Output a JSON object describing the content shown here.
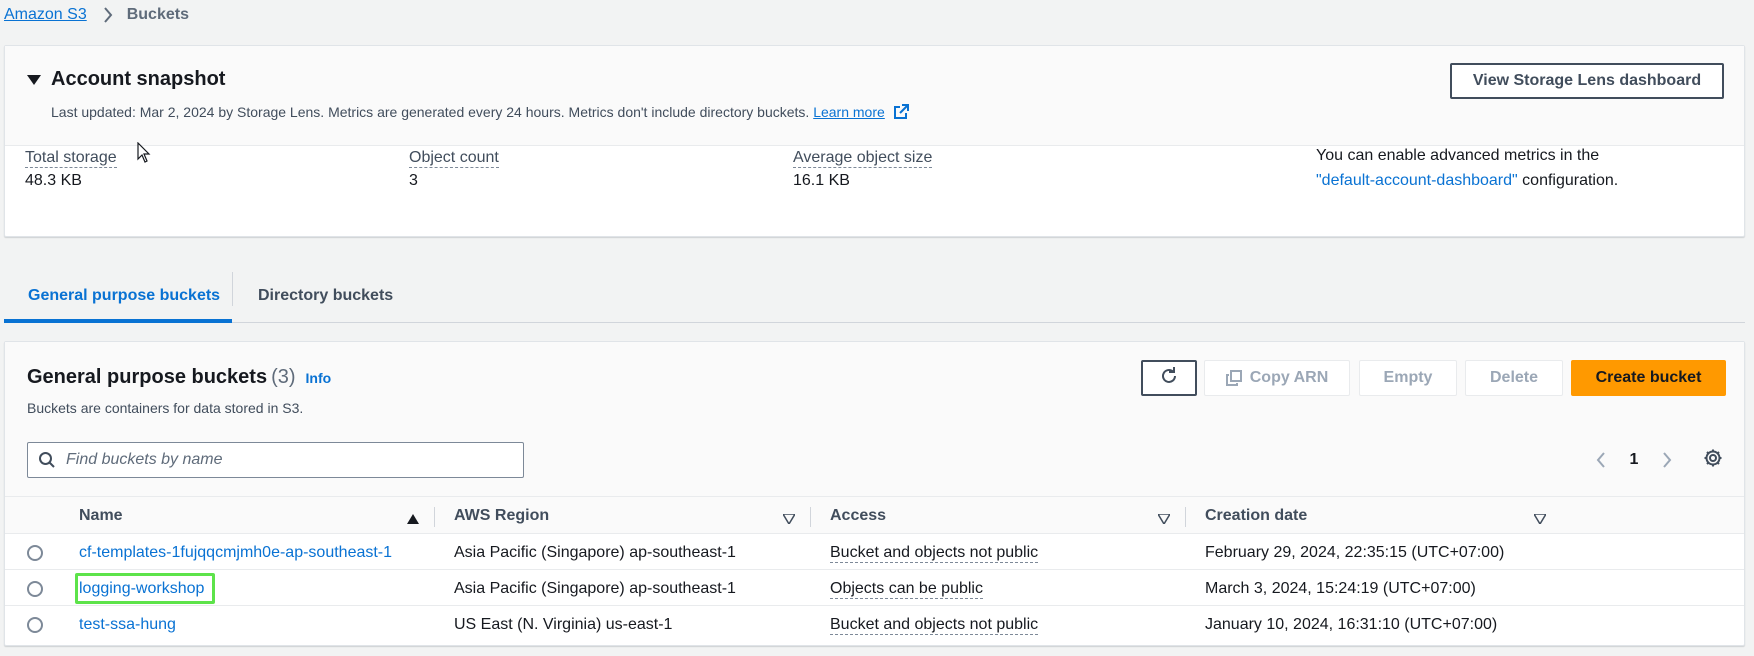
{
  "breadcrumb": {
    "root": "Amazon S3",
    "current": "Buckets"
  },
  "snapshot": {
    "title": "Account snapshot",
    "description": "Last updated: Mar 2, 2024 by Storage Lens. Metrics are generated every 24 hours. Metrics don't include directory buckets.",
    "learn_more": "Learn more",
    "lens_button": "View Storage Lens dashboard",
    "metrics": [
      {
        "label": "Total storage",
        "value": "48.3 KB"
      },
      {
        "label": "Object count",
        "value": "3"
      },
      {
        "label": "Average object size",
        "value": "16.1 KB"
      }
    ],
    "advanced_line1": "You can enable advanced metrics in the",
    "advanced_link": "\"default-account-dashboard\"",
    "advanced_suffix": " configuration."
  },
  "tabs": [
    {
      "label": "General purpose buckets",
      "active": true
    },
    {
      "label": "Directory buckets",
      "active": false
    }
  ],
  "buckets": {
    "title": "General purpose buckets",
    "count": "(3)",
    "info": "Info",
    "description": "Buckets are containers for data stored in S3.",
    "buttons": {
      "copy_arn": "Copy ARN",
      "empty": "Empty",
      "delete": "Delete",
      "create": "Create bucket"
    },
    "search_placeholder": "Find buckets by name",
    "page": "1",
    "columns": [
      "Name",
      "AWS Region",
      "Access",
      "Creation date"
    ],
    "rows": [
      {
        "name": "cf-templates-1fujqqcmjmh0e-ap-southeast-1",
        "region": "Asia Pacific (Singapore) ap-southeast-1",
        "access": "Bucket and objects not public",
        "created": "February 29, 2024, 22:35:15 (UTC+07:00)"
      },
      {
        "name": "logging-workshop",
        "region": "Asia Pacific (Singapore) ap-southeast-1",
        "access": "Objects can be public",
        "created": "March 3, 2024, 15:24:19 (UTC+07:00)"
      },
      {
        "name": "test-ssa-hung",
        "region": "US East (N. Virginia) us-east-1",
        "access": "Bucket and objects not public",
        "created": "January 10, 2024, 16:31:10 (UTC+07:00)"
      }
    ]
  },
  "colors": {
    "link": "#0972d3",
    "primary_button": "#ff9900",
    "highlight": "#5de34a"
  }
}
